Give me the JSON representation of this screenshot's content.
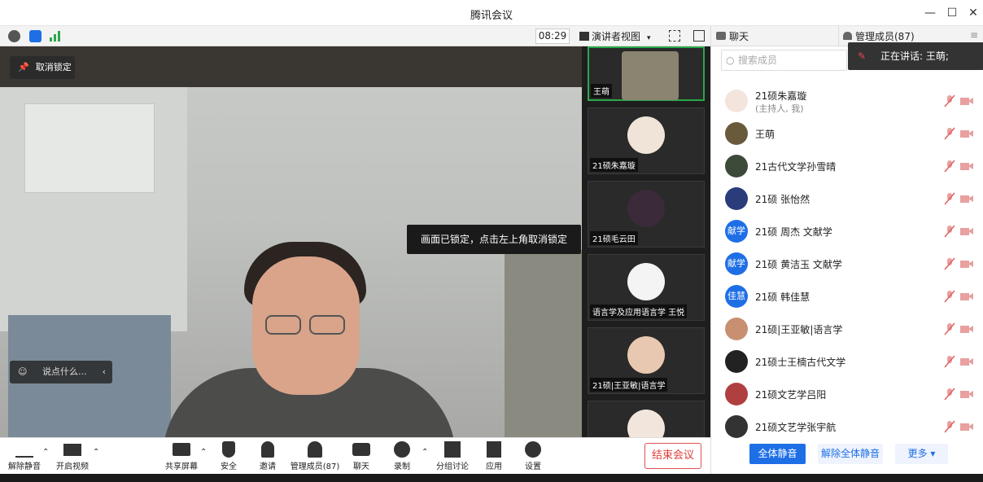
{
  "window": {
    "title": "腾讯会议",
    "minimize": "—",
    "maximize": "☐",
    "close": "✕"
  },
  "top_toolbar": {
    "timer": "08:29",
    "view_mode": "演讲者视图"
  },
  "main_video": {
    "unpin_label": "取消锁定",
    "lock_tip": "画面已锁定，点击左上角取消锁定",
    "chat_placeholder": "说点什么..."
  },
  "thumbnails": [
    {
      "name": "王萌",
      "active": true
    },
    {
      "name": "21硕朱嘉璇",
      "active": false
    },
    {
      "name": "21硕毛云田",
      "active": false
    },
    {
      "name": "语言学及应用语言学 王悦",
      "active": false
    },
    {
      "name": "21硕|王亚敏|语言学",
      "active": false
    }
  ],
  "bottom_toolbar": {
    "unmute": "解除静音",
    "start_video": "开启视频",
    "share_screen": "共享屏幕",
    "security": "安全",
    "invite": "邀请",
    "manage_members": "管理成员(87)",
    "chat": "聊天",
    "record": "录制",
    "breakout": "分组讨论",
    "apps": "应用",
    "settings": "设置",
    "end_meeting": "结束会议"
  },
  "panel": {
    "tab_chat": "聊天",
    "tab_members": "管理成员(87)",
    "search_placeholder": "搜索成员",
    "speaking_now": "正在讲话: 王萌;",
    "members": [
      {
        "name": "21硕朱嘉璇",
        "sub": "(主持人, 我)",
        "avatar": "",
        "color": "#f3e4dc"
      },
      {
        "name": "王萌",
        "sub": "",
        "avatar": "",
        "color": "#6a5a3c"
      },
      {
        "name": "21古代文学孙雪晴",
        "sub": "",
        "avatar": "",
        "color": "#3d4a3a"
      },
      {
        "name": "21硕 张怡然",
        "sub": "",
        "avatar": "",
        "color": "#2a3c7a"
      },
      {
        "name": "21硕 周杰 文献学",
        "sub": "",
        "avatar": "献学",
        "color": "#1e6fe6"
      },
      {
        "name": "21硕 黄洁玉 文献学",
        "sub": "",
        "avatar": "献学",
        "color": "#1e6fe6"
      },
      {
        "name": "21硕 韩佳慧",
        "sub": "",
        "avatar": "佳慧",
        "color": "#1e6fe6"
      },
      {
        "name": "21硕|王亚敏|语言学",
        "sub": "",
        "avatar": "",
        "color": "#c89070"
      },
      {
        "name": "21硕士王楠古代文学",
        "sub": "",
        "avatar": "",
        "color": "#222222"
      },
      {
        "name": "21硕文艺学吕阳",
        "sub": "",
        "avatar": "",
        "color": "#b04040"
      },
      {
        "name": "21硕文艺学张宇航",
        "sub": "",
        "avatar": "",
        "color": "#333333"
      }
    ],
    "mute_all": "全体静音",
    "unmute_all": "解除全体静音",
    "more": "更多 ▾"
  },
  "colors": {
    "accent_blue": "#1e6fe6",
    "end_red": "#e03a3a",
    "active_green": "#2ba84a"
  }
}
